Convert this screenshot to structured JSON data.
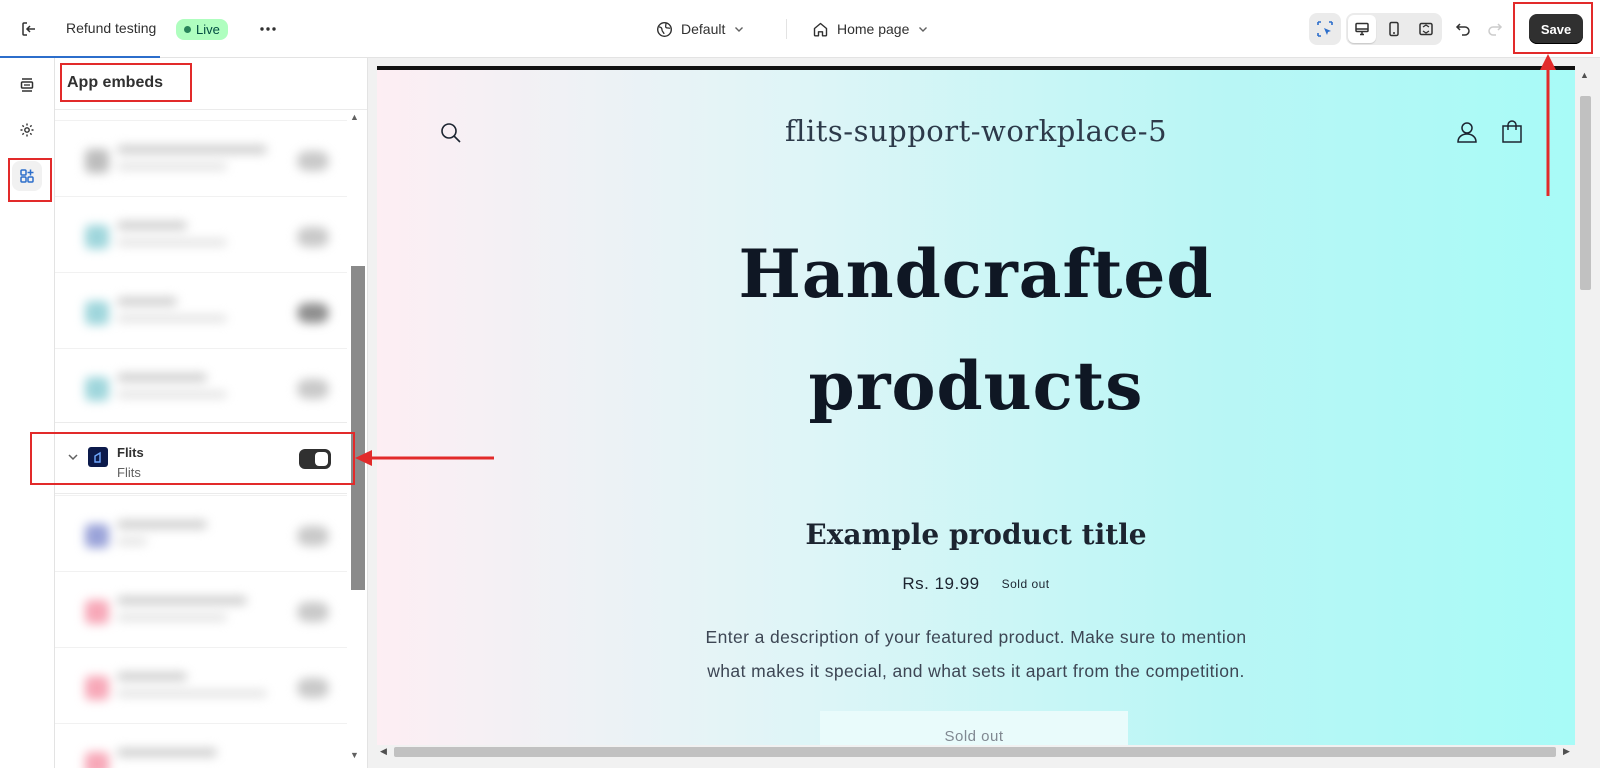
{
  "topbar": {
    "store_name": "Refund testing",
    "status_badge": "Live",
    "theme_label": "Default",
    "page_label": "Home page",
    "save_label": "Save"
  },
  "sidebar": {
    "title": "App embeds",
    "embed": {
      "name": "Flits",
      "subtitle": "Flits",
      "enabled": true
    },
    "blurred_icon_colors": [
      "#bdbdbd",
      "#9fd6dc",
      "#9fd6dc",
      "#9fd6dc",
      "#9aa3d9",
      "#f7a8b8",
      "#f7a8b8"
    ]
  },
  "preview": {
    "store_logo": "flits-support-workplace-5",
    "hero_heading_line1": "Handcrafted",
    "hero_heading_line2": "products",
    "product_title": "Example product title",
    "price": "Rs. 19.99",
    "sold_badge": "Sold out",
    "description_line1": "Enter a description of your featured product. Make sure to mention",
    "description_line2": "what makes it special, and what sets it apart from the competition.",
    "sold_button": "Sold out"
  },
  "colors": {
    "annotation": "#e22a2a",
    "save_button": "#303030",
    "live_badge_bg": "#affebf",
    "accent": "#2c6ecb"
  },
  "icons": [
    "exit-icon",
    "more-icon",
    "globe-icon",
    "home-icon",
    "inspect-icon",
    "desktop-icon",
    "mobile-icon",
    "fullscreen-icon",
    "undo-icon",
    "redo-icon",
    "sections-icon",
    "gear-icon",
    "app-embed-icon",
    "search-icon",
    "account-icon",
    "cart-icon",
    "chevron-down-icon"
  ]
}
